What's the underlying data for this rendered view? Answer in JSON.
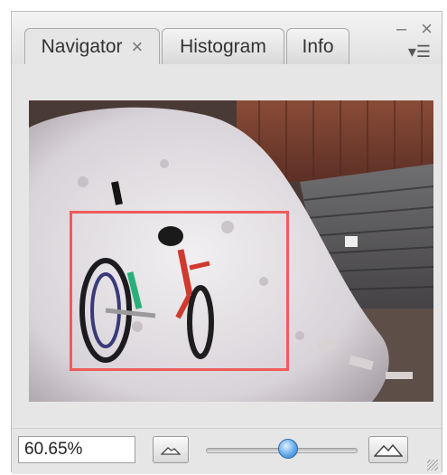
{
  "tabs": [
    {
      "label": "Navigator",
      "active": true
    },
    {
      "label": "Histogram",
      "active": false
    },
    {
      "label": "Info",
      "active": false
    }
  ],
  "window_controls": {
    "minimize_glyph": "–",
    "close_glyph": "×",
    "menu_glyph": "▾☰",
    "tab_close_glyph": "×"
  },
  "zoom": {
    "value": "60.65%",
    "level_fraction": 0.55
  },
  "icons": {
    "zoom_out": "mountain-small-icon",
    "zoom_in": "mountain-large-icon"
  },
  "colors": {
    "view_rect": "#f05b5b",
    "slider_knob": "#5aa3e6"
  }
}
